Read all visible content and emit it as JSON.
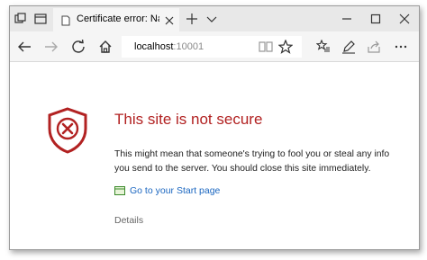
{
  "tab": {
    "title": "Certificate error: Naviga"
  },
  "address_bar": {
    "host": "localhost",
    "port": ":10001"
  },
  "error": {
    "title": "This site is not secure",
    "description": "This might mean that someone's trying to fool you or steal any info you send to the server. You should close this site immediately.",
    "start_link": "Go to your Start page",
    "details": "Details"
  },
  "colors": {
    "accent_red": "#b22222",
    "link_blue": "#1a66c0"
  },
  "icons": {
    "tab_manager": "tab-manager-icon",
    "tab_preview": "tab-preview-icon",
    "favicon": "page-icon",
    "close_tab": "close-icon",
    "new_tab": "plus-icon",
    "tab_list": "chevron-down-icon",
    "minimize": "minimize-icon",
    "maximize": "maximize-icon",
    "close_window": "close-icon",
    "back": "back-arrow-icon",
    "forward": "forward-arrow-icon",
    "refresh": "refresh-icon",
    "home": "home-icon",
    "reading_view": "book-icon",
    "favorite": "star-icon",
    "favorites_hub": "favorites-icon",
    "notes": "pen-icon",
    "share": "share-icon",
    "shield": "shield-error-icon",
    "start_page": "start-page-icon"
  }
}
